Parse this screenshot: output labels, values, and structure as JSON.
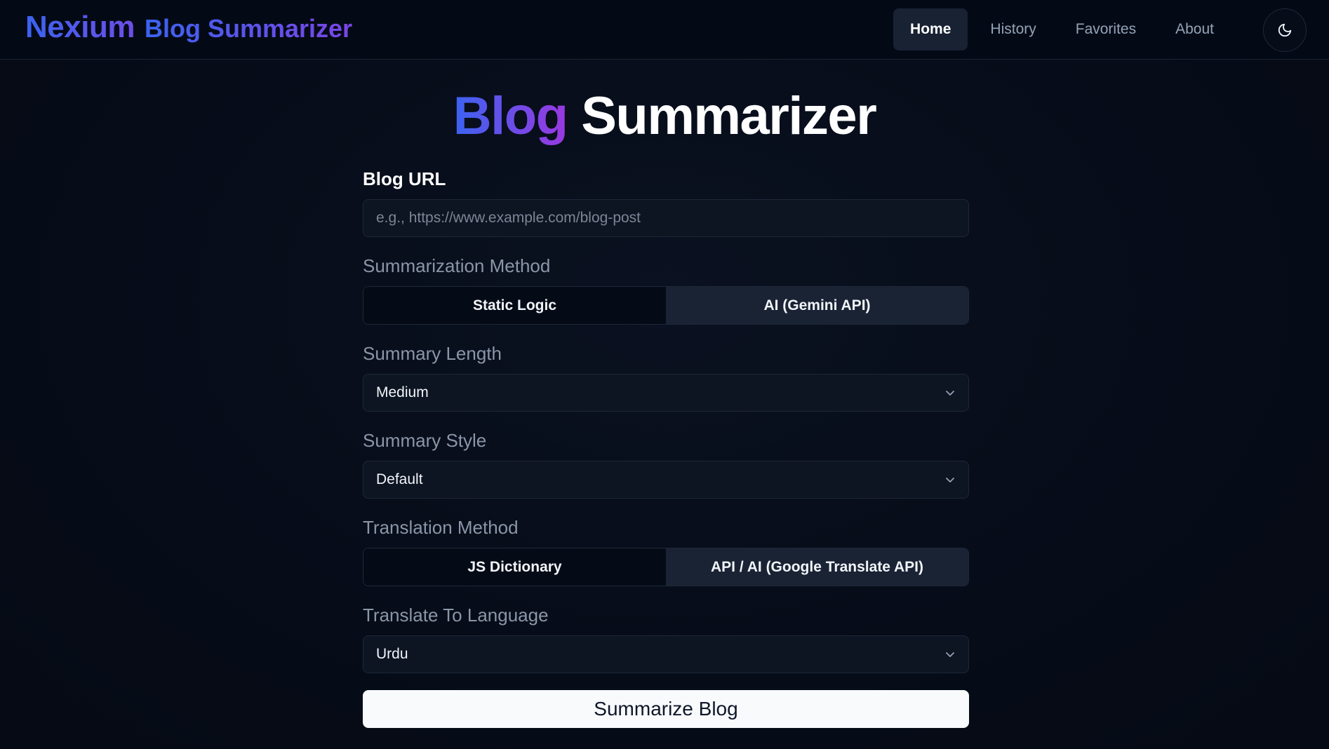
{
  "header": {
    "brand_main": "Nexium",
    "brand_sub": "Blog Summarizer",
    "nav": [
      {
        "label": "Home",
        "active": true
      },
      {
        "label": "History",
        "active": false
      },
      {
        "label": "Favorites",
        "active": false
      },
      {
        "label": "About",
        "active": false
      }
    ],
    "theme_icon": "moon-icon"
  },
  "main": {
    "title_accent": "Blog",
    "title_rest": "Summarizer",
    "url": {
      "label": "Blog URL",
      "placeholder": "e.g., https://www.example.com/blog-post",
      "value": ""
    },
    "summarization_method": {
      "label": "Summarization Method",
      "options": [
        "Static Logic",
        "AI (Gemini API)"
      ],
      "selected": "AI (Gemini API)"
    },
    "summary_length": {
      "label": "Summary Length",
      "value": "Medium"
    },
    "summary_style": {
      "label": "Summary Style",
      "value": "Default"
    },
    "translation_method": {
      "label": "Translation Method",
      "options": [
        "JS Dictionary",
        "API / AI (Google Translate API)"
      ],
      "selected": "API / AI (Google Translate API)"
    },
    "target_language": {
      "label": "Translate To Language",
      "value": "Urdu"
    },
    "submit_label": "Summarize Blog"
  },
  "colors": {
    "background": "#050b16",
    "accent_start": "#3b63f0",
    "accent_end": "#9a38e0",
    "button_bg": "#f8fafc"
  }
}
